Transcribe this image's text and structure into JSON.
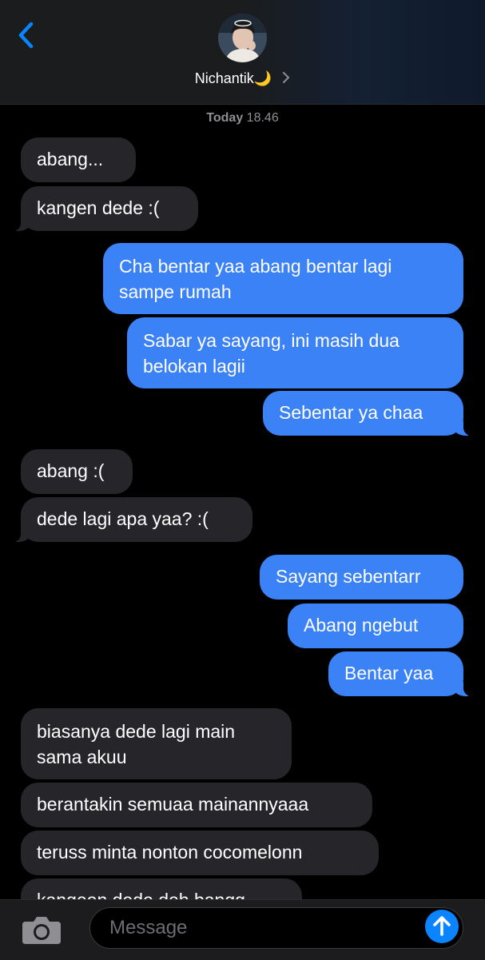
{
  "header": {
    "contact_name": "Nichantik🌙",
    "back_icon": "chevron-left-icon",
    "details_icon": "chevron-right-icon",
    "accent_color": "#0a84ff"
  },
  "timestamp": {
    "day": "Today",
    "time": "18.46"
  },
  "messages": [
    {
      "from": "contact",
      "text": "abang..."
    },
    {
      "from": "contact",
      "text": "kangen dede :("
    },
    {
      "from": "me",
      "line1": "Cha bentar yaa abang bentar lagi",
      "line2": "sampe rumah"
    },
    {
      "from": "me",
      "line1": "Sabar ya sayang, ini masih dua",
      "line2": "belokan lagii"
    },
    {
      "from": "me",
      "text": "Sebentar ya chaa"
    },
    {
      "from": "contact",
      "text": "abang :("
    },
    {
      "from": "contact",
      "text": "dede lagi apa yaa? :("
    },
    {
      "from": "me",
      "text": "Sayang sebentarr"
    },
    {
      "from": "me",
      "text": "Abang ngebut"
    },
    {
      "from": "me",
      "text": "Bentar yaa"
    },
    {
      "from": "contact",
      "line1": "biasanya dede lagi main",
      "line2": "sama akuu"
    },
    {
      "from": "contact",
      "text": "berantakin semuaa mainannyaaa"
    },
    {
      "from": "contact",
      "text": "teruss minta nonton cocomelonn"
    },
    {
      "from": "contact",
      "text": "kangeen dede deh bangg"
    }
  ],
  "composer": {
    "placeholder": "Message",
    "camera_icon": "camera-icon",
    "send_icon": "arrow-up-icon"
  },
  "colors": {
    "outgoing": "#3b82f6",
    "incoming": "#26252a",
    "background": "#000000"
  }
}
